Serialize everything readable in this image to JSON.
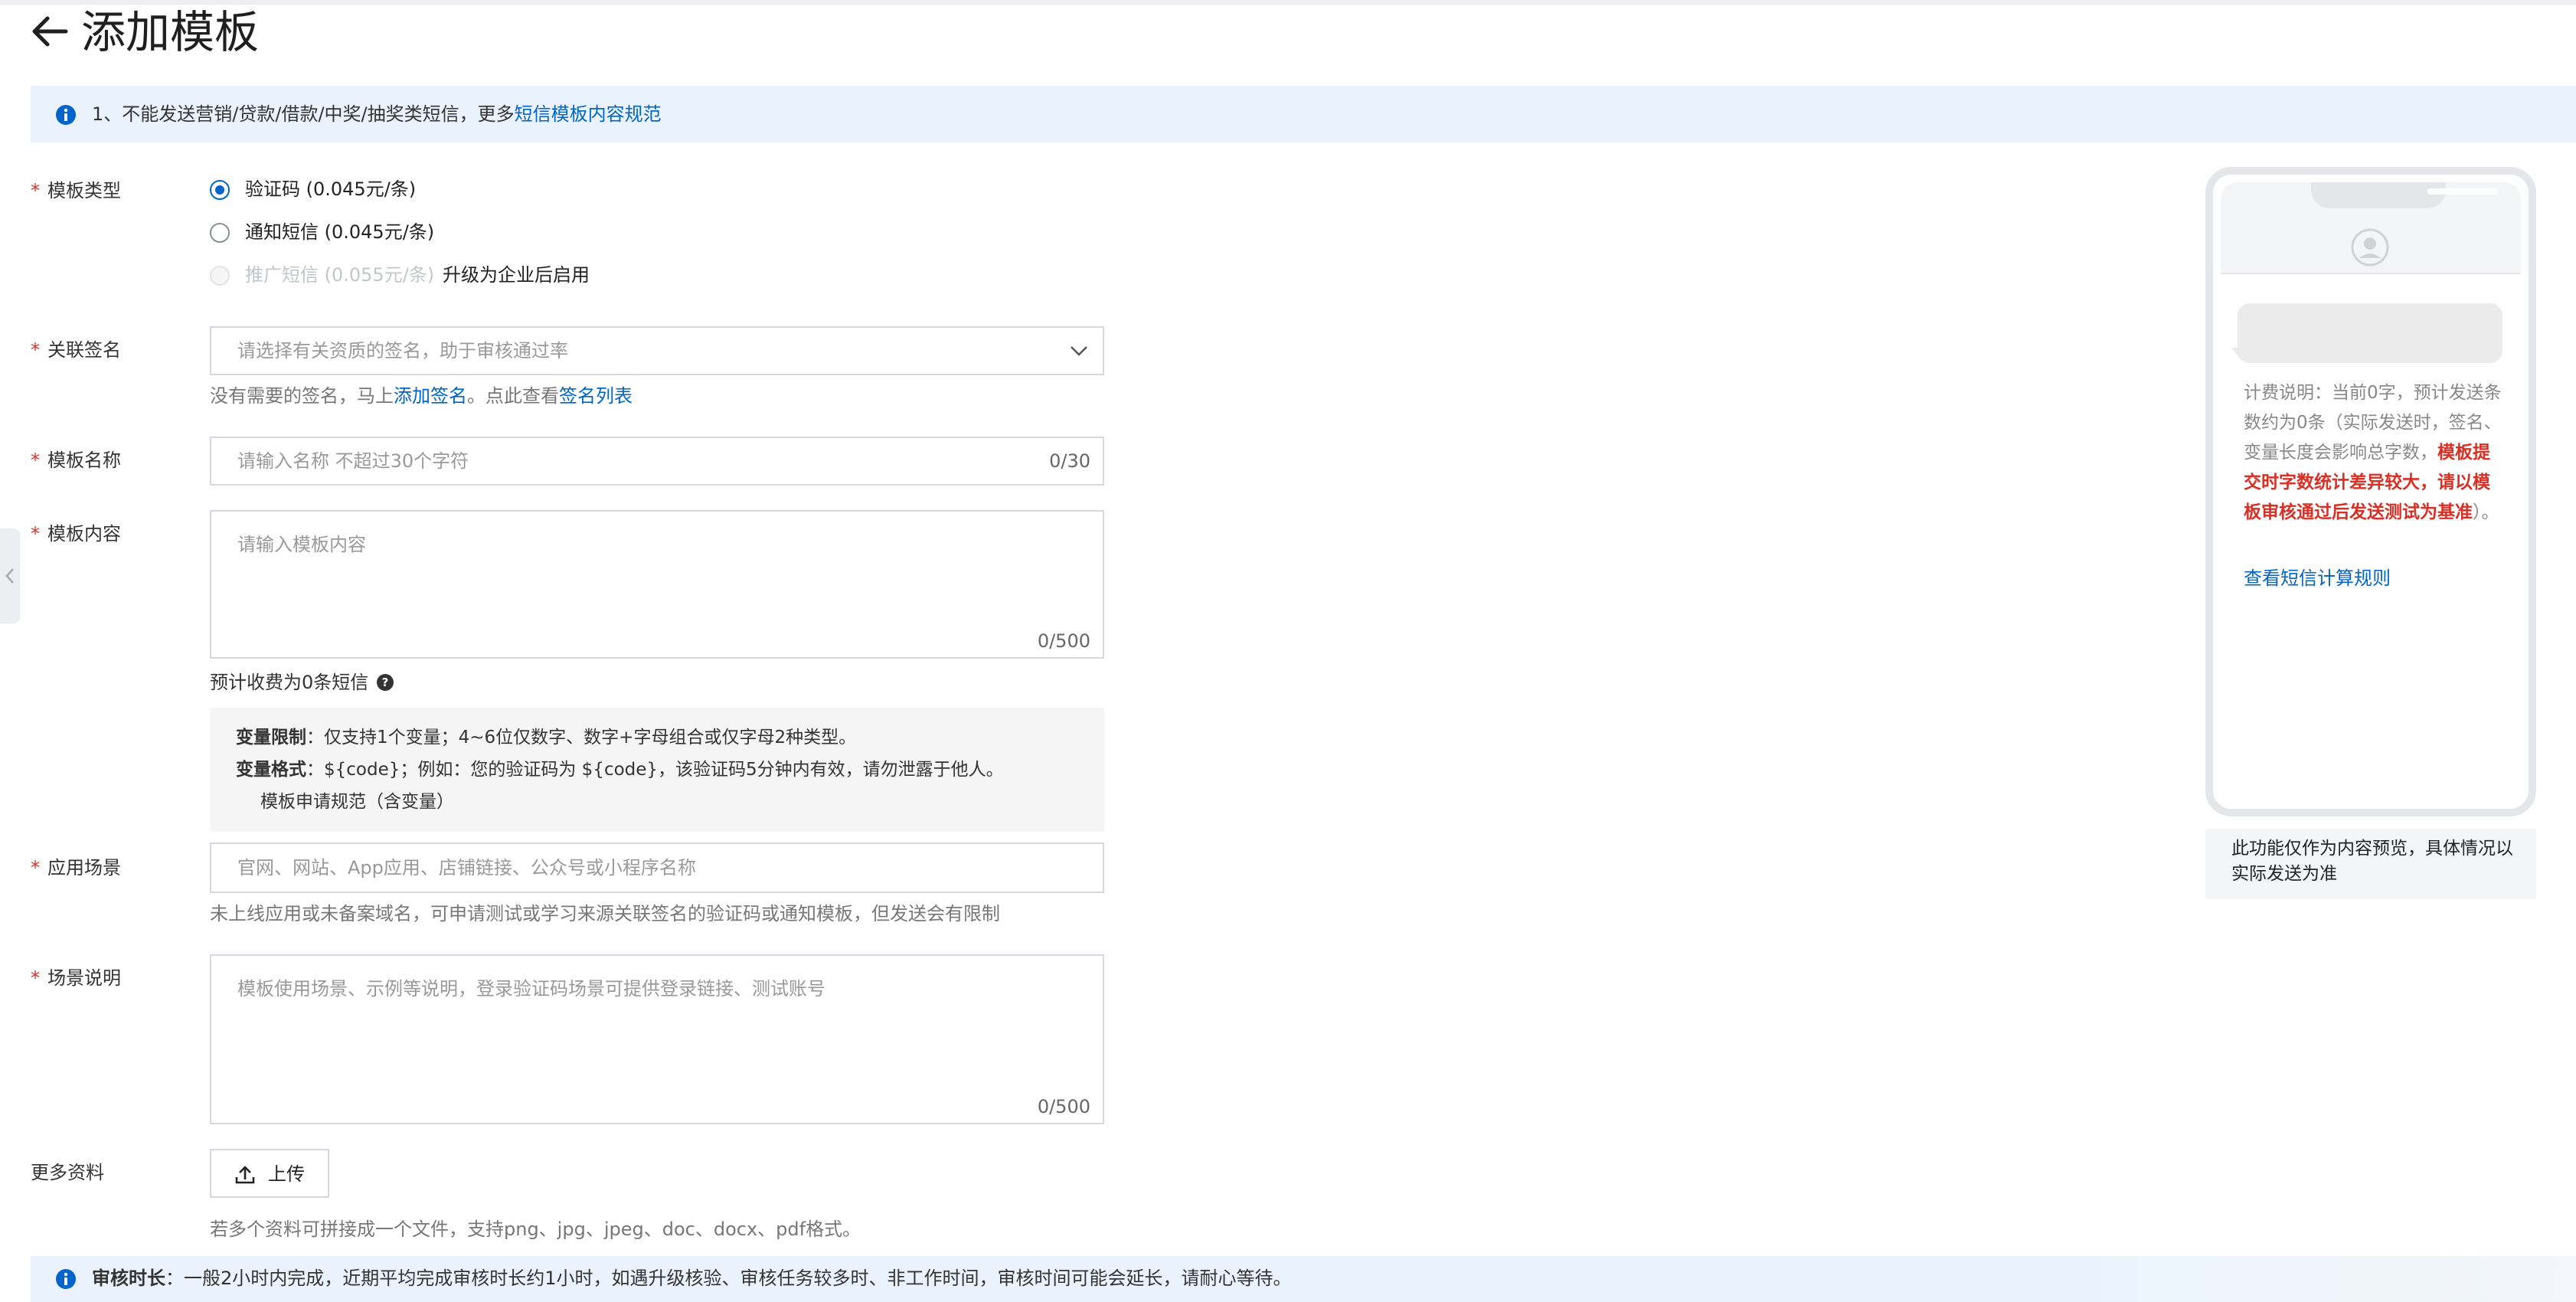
{
  "header": {
    "title": "添加模板"
  },
  "notice": {
    "text": "1、不能发送营销/贷款/借款/中奖/抽奖类短信，更多",
    "link": "短信模板内容规范"
  },
  "form": {
    "template_type": {
      "label": "模板类型",
      "options": [
        {
          "label": "验证码 (0.045元/条)",
          "checked": true
        },
        {
          "label": "通知短信 (0.045元/条)",
          "checked": false
        },
        {
          "label": "推广短信 (0.055元/条)",
          "disabled": true,
          "suffix": "升级为企业后启用"
        }
      ]
    },
    "signature": {
      "label": "关联签名",
      "placeholder": "请选择有关资质的签名，助于审核通过率",
      "helper_prefix": "没有需要的签名，马上",
      "helper_link1": "添加签名",
      "helper_mid": "。点此查看",
      "helper_link2": "签名列表"
    },
    "name": {
      "label": "模板名称",
      "placeholder": "请输入名称 不超过30个字符",
      "counter": "0/30"
    },
    "content": {
      "label": "模板内容",
      "placeholder": "请输入模板内容",
      "counter": "0/500",
      "estimate": "预计收费为0条短信",
      "var_limit_label": "变量限制",
      "var_limit_text": "：仅支持1个变量；4~6位仅数字、数字+字母组合或仅字母2种类型。",
      "var_format_label": "变量格式",
      "var_format_text": "：${code}；例如：您的验证码为 ${code}，该验证码5分钟内有效，请勿泄露于他人。",
      "var_link": "模板申请规范（含变量）"
    },
    "scene": {
      "label": "应用场景",
      "placeholder": "官网、网站、App应用、店铺链接、公众号或小程序名称",
      "helper": "未上线应用或未备案域名，可申请测试或学习来源关联签名的验证码或通知模板，但发送会有限制"
    },
    "scene_desc": {
      "label": "场景说明",
      "placeholder": "模板使用场景、示例等说明，登录验证码场景可提供登录链接、测试账号",
      "counter": "0/500"
    },
    "more": {
      "label": "更多资料",
      "upload": "上传",
      "helper": "若多个资料可拼接成一个文件，支持png、jpg、jpeg、doc、docx、pdf格式。"
    }
  },
  "review": {
    "label": "审核时长",
    "text": "：一般2小时内完成，近期平均完成审核时长约1小时，如遇升级核验、审核任务较多时、非工作时间，审核时间可能会延长，请耐心等待。"
  },
  "preview": {
    "fee_normal": "计费说明：当前0字，预计发送条数约为0条（实际发送时，签名、变量长度会影响总字数，",
    "fee_warn": "模板提交时字数统计差异较大，请以模板审核通过后发送测试为基准",
    "fee_end": "）。",
    "rule_link": "查看短信计算规则",
    "note": "此功能仅作为内容预览，具体情况以实际发送为准"
  },
  "colors": {
    "accent": "#0064c8",
    "required": "#d93026",
    "info_bg": "#eaf3fd"
  }
}
